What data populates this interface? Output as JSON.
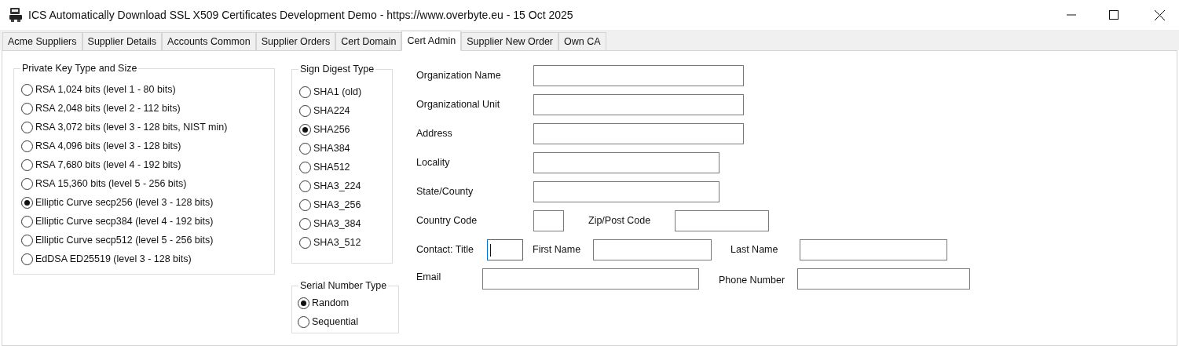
{
  "window": {
    "title": "ICS Automatically Download SSL X509 Certificates Development Demo - https://www.overbyte.eu  - 15 Oct 2025"
  },
  "tabs": [
    {
      "label": "Acme Suppliers",
      "selected": false
    },
    {
      "label": "Supplier Details",
      "selected": false
    },
    {
      "label": "Accounts Common",
      "selected": false
    },
    {
      "label": "Supplier Orders",
      "selected": false
    },
    {
      "label": "Cert Domain",
      "selected": false
    },
    {
      "label": "Cert Admin",
      "selected": true
    },
    {
      "label": "Supplier New Order",
      "selected": false
    },
    {
      "label": "Own CA",
      "selected": false
    }
  ],
  "private_key": {
    "title": "Private Key Type and Size",
    "options": [
      {
        "label": "RSA 1,024 bits (level 1 - 80 bits)",
        "selected": false
      },
      {
        "label": "RSA 2,048 bits (level 2 - 112 bits)",
        "selected": false
      },
      {
        "label": "RSA 3,072 bits (level 3 - 128 bits, NIST min)",
        "selected": false
      },
      {
        "label": "RSA 4,096 bits (level 3 - 128 bits)",
        "selected": false
      },
      {
        "label": "RSA 7,680 bits (level 4 - 192 bits)",
        "selected": false
      },
      {
        "label": "RSA 15,360 bits (level 5 - 256 bits)",
        "selected": false
      },
      {
        "label": "Elliptic Curve secp256  (level 3 - 128 bits)",
        "selected": true
      },
      {
        "label": "Elliptic Curve secp384  (level 4 - 192 bits)",
        "selected": false
      },
      {
        "label": "Elliptic Curve secp512  (level 5 - 256 bits)",
        "selected": false
      },
      {
        "label": "EdDSA ED25519 (level 3 - 128 bits)",
        "selected": false
      }
    ]
  },
  "sign_digest": {
    "title": "Sign Digest Type",
    "options": [
      {
        "label": "SHA1 (old)",
        "selected": false
      },
      {
        "label": "SHA224",
        "selected": false
      },
      {
        "label": "SHA256",
        "selected": true
      },
      {
        "label": "SHA384",
        "selected": false
      },
      {
        "label": "SHA512",
        "selected": false
      },
      {
        "label": "SHA3_224",
        "selected": false
      },
      {
        "label": "SHA3_256",
        "selected": false
      },
      {
        "label": "SHA3_384",
        "selected": false
      },
      {
        "label": "SHA3_512",
        "selected": false
      }
    ]
  },
  "serial_number": {
    "title": "Serial Number Type",
    "options": [
      {
        "label": "Random",
        "selected": true
      },
      {
        "label": "Sequential",
        "selected": false
      }
    ]
  },
  "form": {
    "fields": [
      {
        "label": "Organization Name",
        "focused": false
      },
      {
        "label": "Organizational Unit",
        "focused": false
      },
      {
        "label": "Address",
        "focused": false
      },
      {
        "label": "Locality",
        "focused": false
      },
      {
        "label": "State/County",
        "focused": false
      },
      {
        "label": "Country Code",
        "focused": false
      },
      {
        "label": "Zip/Post Code",
        "focused": false
      },
      {
        "label": "Contact: Title",
        "focused": true
      },
      {
        "label": "First Name",
        "focused": false
      },
      {
        "label": "Last Name",
        "focused": false
      },
      {
        "label": "Email",
        "focused": false
      },
      {
        "label": "Phone Number",
        "focused": false
      }
    ]
  }
}
